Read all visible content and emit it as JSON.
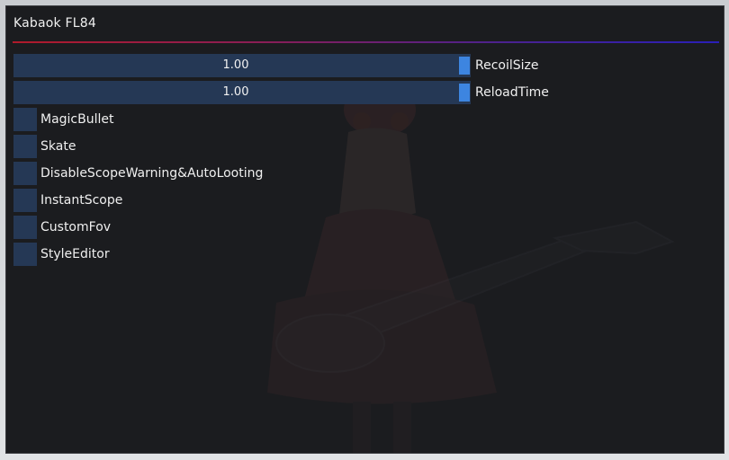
{
  "window": {
    "title": "Kabaok FL84"
  },
  "sliders": [
    {
      "value_text": "1.00",
      "label": "RecoilSize"
    },
    {
      "value_text": "1.00",
      "label": "ReloadTime"
    }
  ],
  "checkboxes": [
    {
      "label": "MagicBullet",
      "checked": false
    },
    {
      "label": "Skate",
      "checked": false
    },
    {
      "label": "DisableScopeWarning&AutoLooting",
      "checked": false
    },
    {
      "label": "InstantScope",
      "checked": false
    },
    {
      "label": "CustomFov",
      "checked": false
    },
    {
      "label": "StyleEditor",
      "checked": false
    }
  ],
  "colors": {
    "window_bg": "#1b1c1f",
    "frame_bg": "#253855",
    "slider_grab": "#3d85e0",
    "text": "#f0f0f0",
    "separator_start": "#b01a2a",
    "separator_end": "#2a1fb8"
  }
}
